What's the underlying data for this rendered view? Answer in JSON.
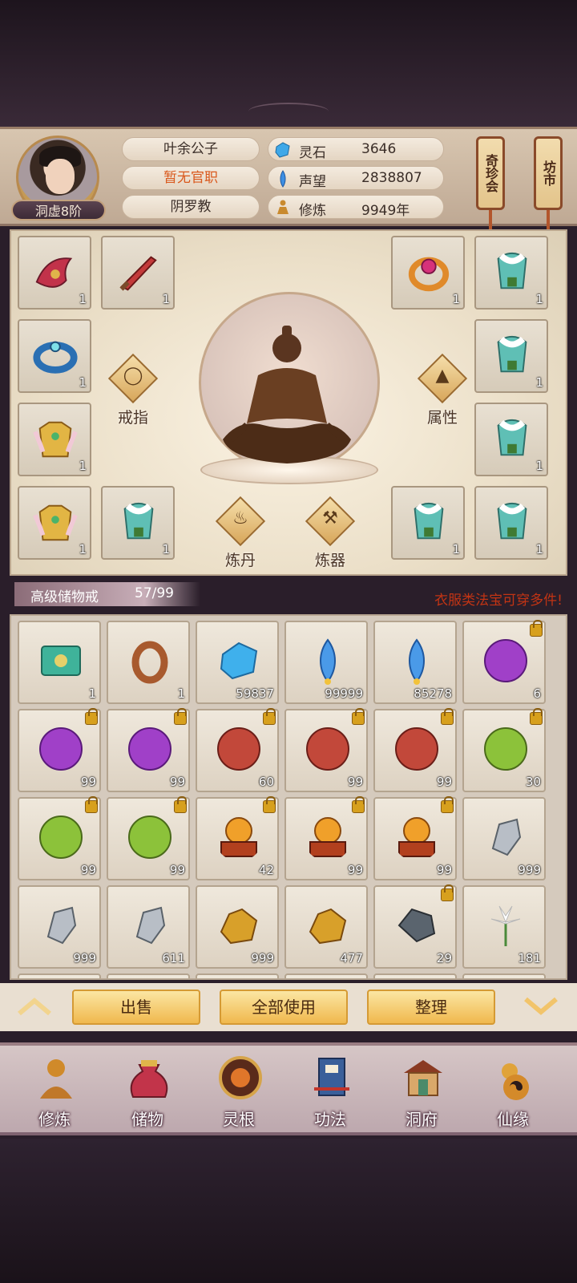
{
  "header": {
    "player_name": "叶余公子",
    "official_title": "暂无官职",
    "sect": "阴罗教",
    "rank": "洞虚8阶",
    "stats": [
      {
        "label": "灵石",
        "value": "3646",
        "icon": "spirit-stone-icon"
      },
      {
        "label": "声望",
        "value": "2838807",
        "icon": "prestige-icon"
      },
      {
        "label": "修炼",
        "value": "9949年",
        "icon": "meditation-icon"
      }
    ],
    "side_buttons": [
      "奇珍会",
      "坊市"
    ]
  },
  "equipment": {
    "slots": [
      {
        "name": "phoenix-gauntlet",
        "count": "1"
      },
      {
        "name": "crimson-dagger",
        "count": "1"
      },
      {
        "name": "jade-ring",
        "count": "1"
      },
      {
        "name": "golden-armor",
        "count": "1"
      },
      {
        "name": "golden-armor",
        "count": "1"
      },
      {
        "name": "fur-robe",
        "count": "1"
      },
      {
        "name": "gem-ring",
        "count": "1"
      },
      {
        "name": "fur-robe",
        "count": "1"
      },
      {
        "name": "fur-robe",
        "count": "1"
      },
      {
        "name": "fur-robe",
        "count": "1"
      },
      {
        "name": "fur-robe",
        "count": "1"
      },
      {
        "name": "fur-robe",
        "count": "1"
      }
    ],
    "actions": {
      "ring": "戒指",
      "attributes": "属性",
      "alchemy": "炼丹",
      "forging": "炼器"
    }
  },
  "bag": {
    "title": "高级储物戒",
    "capacity": "57/99",
    "note": "衣服类法宝可穿多件!",
    "items": [
      {
        "icon": "jade-box-icon",
        "count": "1",
        "locked": false
      },
      {
        "icon": "bronze-ring-icon",
        "count": "1",
        "locked": false
      },
      {
        "icon": "blue-spirit-stone-icon",
        "count": "59837",
        "locked": false
      },
      {
        "icon": "blue-crystal-icon",
        "count": "99999",
        "locked": false
      },
      {
        "icon": "blue-crystal-icon",
        "count": "85278",
        "locked": false
      },
      {
        "icon": "purple-orb-icon",
        "count": "6",
        "locked": true
      },
      {
        "icon": "purple-orb-icon",
        "count": "99",
        "locked": true
      },
      {
        "icon": "purple-orb-icon",
        "count": "99",
        "locked": true
      },
      {
        "icon": "red-orb-icon",
        "count": "60",
        "locked": true
      },
      {
        "icon": "red-orb-icon",
        "count": "99",
        "locked": true
      },
      {
        "icon": "red-orb-icon",
        "count": "99",
        "locked": true
      },
      {
        "icon": "green-orb-icon",
        "count": "30",
        "locked": true
      },
      {
        "icon": "green-orb-icon",
        "count": "99",
        "locked": true
      },
      {
        "icon": "green-orb-icon",
        "count": "99",
        "locked": true
      },
      {
        "icon": "gold-orb-pedestal-icon",
        "count": "42",
        "locked": true
      },
      {
        "icon": "gold-orb-pedestal-icon",
        "count": "99",
        "locked": true
      },
      {
        "icon": "gold-orb-pedestal-icon",
        "count": "99",
        "locked": true
      },
      {
        "icon": "silver-ore-icon",
        "count": "999",
        "locked": false
      },
      {
        "icon": "silver-ore-icon",
        "count": "999",
        "locked": false
      },
      {
        "icon": "silver-ore-icon",
        "count": "611",
        "locked": false
      },
      {
        "icon": "gold-ore-icon",
        "count": "999",
        "locked": false
      },
      {
        "icon": "gold-ore-icon",
        "count": "477",
        "locked": false
      },
      {
        "icon": "dark-ore-icon",
        "count": "29",
        "locked": true
      },
      {
        "icon": "white-flower-icon",
        "count": "181",
        "locked": false
      }
    ]
  },
  "actions": {
    "sell": "出售",
    "use_all": "全部使用",
    "sort": "整理"
  },
  "nav": [
    {
      "label": "修炼",
      "icon": "cultivate-icon"
    },
    {
      "label": "储物",
      "icon": "storage-bag-icon"
    },
    {
      "label": "灵根",
      "icon": "spirit-root-icon"
    },
    {
      "label": "功法",
      "icon": "technique-book-icon"
    },
    {
      "label": "洞府",
      "icon": "cave-dwelling-icon"
    },
    {
      "label": "仙缘",
      "icon": "immortal-fate-icon"
    }
  ]
}
